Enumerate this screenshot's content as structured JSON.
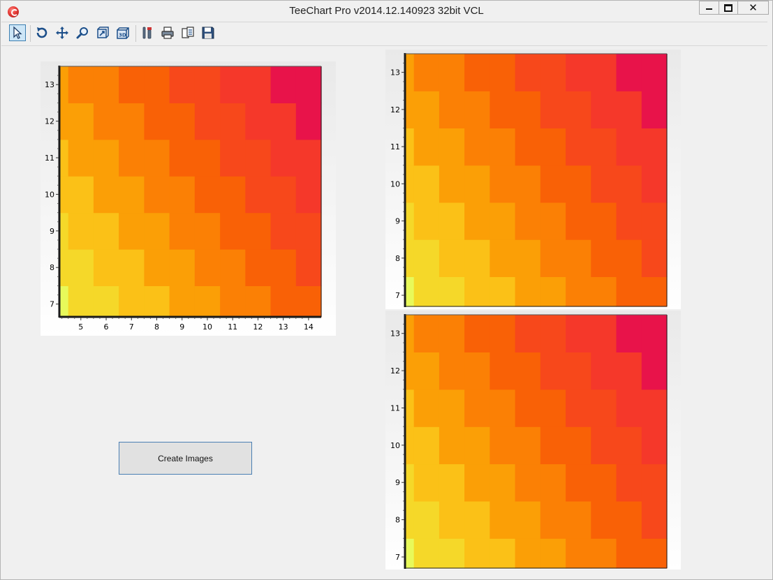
{
  "window": {
    "title": "TeeChart Pro v2014.12.140923 32bit VCL",
    "app_icon": "teechart-logo-icon",
    "controls": {
      "minimize": "minimize-icon",
      "maximize": "maximize-icon",
      "close": "close-icon"
    }
  },
  "toolbar": {
    "tools": [
      {
        "name": "select-arrow-icon",
        "selected": true
      },
      {
        "name": "rotate-icon"
      },
      {
        "name": "move-icon"
      },
      {
        "name": "zoom-icon"
      },
      {
        "name": "depth-icon"
      },
      {
        "name": "view3d-icon"
      },
      {
        "name": "edit-settings-icon"
      },
      {
        "name": "print-icon"
      },
      {
        "name": "export-icon"
      },
      {
        "name": "save-icon"
      }
    ]
  },
  "create_button": {
    "label": "Create Images"
  },
  "colors": {
    "gradient_low": "#e8f95a",
    "gradient_mid1": "#f5d829",
    "gradient_mid2": "#fbc117",
    "gradient_mid3": "#fb9f06",
    "gradient_mid4": "#fb8005",
    "gradient_mid5": "#f96106",
    "gradient_mid6": "#f7481b",
    "gradient_mid7": "#f5382a",
    "gradient_high": "#e8134a"
  },
  "chart_data": [
    {
      "type": "heatmap",
      "x": [
        4,
        5,
        6,
        7,
        8,
        9,
        10,
        11,
        12,
        13,
        14
      ],
      "y": [
        7,
        8,
        9,
        10,
        11,
        12,
        13
      ],
      "x_ticks": [
        "5",
        "6",
        "7",
        "8",
        "9",
        "10",
        "11",
        "12",
        "13",
        "14"
      ],
      "y_ticks": [
        "7",
        "8",
        "9",
        "10",
        "11",
        "12",
        "13"
      ],
      "xlim": [
        4.15,
        14.5
      ],
      "ylim": [
        6.65,
        13.5
      ],
      "palette": [
        "#e8f95a",
        "#f5d829",
        "#fbc117",
        "#fb9f06",
        "#fb8005",
        "#f96106",
        "#f7481b",
        "#f5382a",
        "#e8134a"
      ],
      "value_rule": "x + y",
      "value_range": [
        11,
        27
      ]
    },
    {
      "type": "heatmap",
      "x": [
        4,
        5,
        6,
        7,
        8,
        9,
        10,
        11,
        12,
        13,
        14
      ],
      "y": [
        7,
        8,
        9,
        10,
        11,
        12,
        13
      ],
      "x_ticks": [],
      "y_ticks": [
        "7",
        "8",
        "9",
        "10",
        "11",
        "12",
        "13"
      ],
      "xlim": [
        4.15,
        14.5
      ],
      "ylim": [
        6.7,
        13.5
      ],
      "palette": [
        "#e8f95a",
        "#f5d829",
        "#fbc117",
        "#fb9f06",
        "#fb8005",
        "#f96106",
        "#f7481b",
        "#f5382a",
        "#e8134a"
      ],
      "value_rule": "x + y",
      "value_range": [
        11,
        27
      ]
    },
    {
      "type": "heatmap",
      "x": [
        4,
        5,
        6,
        7,
        8,
        9,
        10,
        11,
        12,
        13,
        14
      ],
      "y": [
        7,
        8,
        9,
        10,
        11,
        12,
        13
      ],
      "x_ticks": [],
      "y_ticks": [
        "7",
        "8",
        "9",
        "10",
        "11",
        "12",
        "13"
      ],
      "xlim": [
        4.15,
        14.5
      ],
      "ylim": [
        6.7,
        13.5
      ],
      "palette": [
        "#e8f95a",
        "#f5d829",
        "#fbc117",
        "#fb9f06",
        "#fb8005",
        "#f96106",
        "#f7481b",
        "#f5382a",
        "#e8134a"
      ],
      "value_rule": "x + y",
      "value_range": [
        11,
        27
      ]
    }
  ]
}
